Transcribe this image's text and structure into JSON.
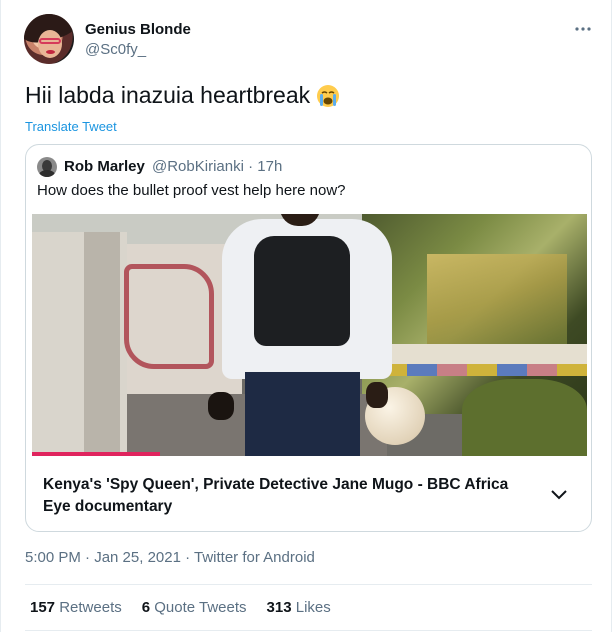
{
  "author": {
    "name": "Genius Blonde",
    "handle": "@Sc0fy_"
  },
  "tweet": {
    "text": "Hii labda inazuia heartbreak",
    "emoji": "loudly-crying-face",
    "translate_label": "Translate Tweet"
  },
  "quote": {
    "name": "Rob Marley",
    "handle": "@RobKirianki · 17h",
    "text": "How does the bullet proof vest  help here now?",
    "video_progress": 0.23,
    "card_title": "Kenya's 'Spy Queen', Private Detective Jane Mugo - BBC Africa Eye documentary"
  },
  "meta": {
    "timestamp_source": "5:00 PM · Jan 25, 2021 · Twitter for Android"
  },
  "stats": {
    "retweets_count": "157",
    "retweets_label": "Retweets",
    "quotes_count": "6",
    "quotes_label": "Quote Tweets",
    "likes_count": "313",
    "likes_label": "Likes"
  },
  "colors": {
    "link": "#1b95e0",
    "muted": "#5b7083",
    "text": "#0f1419",
    "progress": "#e0245e"
  }
}
